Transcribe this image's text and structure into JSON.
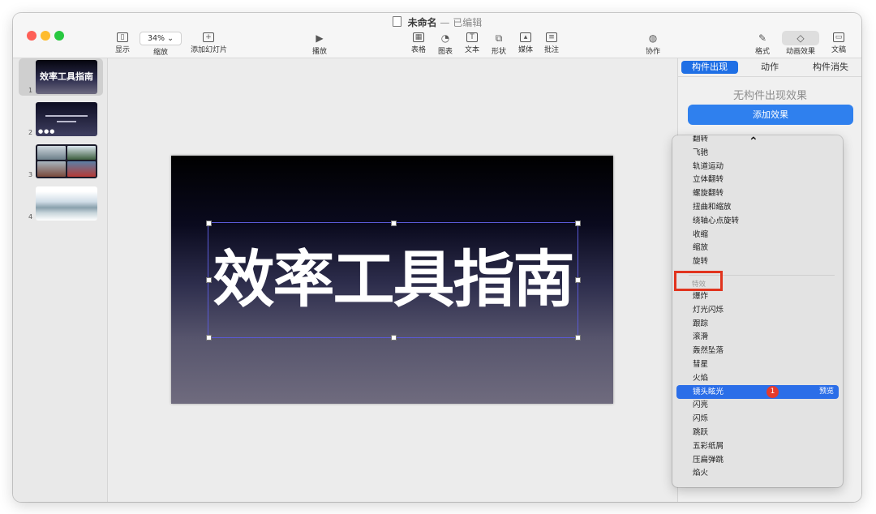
{
  "window": {
    "title": "未命名",
    "separator": "—",
    "status": "已编辑"
  },
  "toolbar": {
    "view_label": "显示",
    "zoom_value": "34% ⌄",
    "zoom_label": "缩放",
    "add_slide_label": "添加幻灯片",
    "play_label": "播放",
    "table_label": "表格",
    "chart_label": "图表",
    "text_label": "文本",
    "shape_label": "形状",
    "media_label": "媒体",
    "comment_label": "批注",
    "collaborate_label": "协作",
    "format_label": "格式",
    "animate_label": "动画效果",
    "document_label": "文稿"
  },
  "navigator": {
    "slides": [
      {
        "number": "1",
        "title": "效率工具指南"
      },
      {
        "number": "2",
        "dots": "●●●"
      },
      {
        "number": "3"
      },
      {
        "number": "4"
      }
    ]
  },
  "slide": {
    "title": "效率工具指南"
  },
  "inspector": {
    "tabs": [
      "构件出现",
      "动作",
      "构件消失"
    ],
    "no_effect": "无构件出现效果",
    "add_effect": "添加效果"
  },
  "effects_menu": {
    "items_before": [
      "翻转",
      "飞驰",
      "轨道运动",
      "立体翻转",
      "螺旋翻转",
      "扭曲和缩放",
      "绕轴心点旋转",
      "收缩",
      "缩放",
      "旋转"
    ],
    "section_header": "特效",
    "items_after": [
      "爆炸",
      "灯光闪烁",
      "跟踪",
      "滚滑",
      "轰然坠落",
      "彗星",
      "火焰",
      "镜头眩光",
      "闪亮",
      "闪烁",
      "跳跃",
      "五彩纸屑",
      "压扁弹跳",
      "焰火"
    ],
    "highlighted": "镜头眩光",
    "preview_label": "预览",
    "badge": "1"
  },
  "colors": {
    "accent": "#2f80ee",
    "highlight": "#2b6ee8",
    "annotation": "#e1341e"
  }
}
